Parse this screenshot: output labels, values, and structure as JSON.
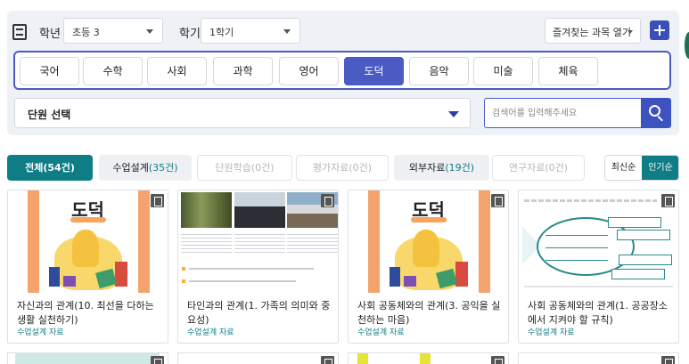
{
  "filter_bar": {
    "grade_label": "학년",
    "grade_value": "초등 3",
    "semester_label": "학기",
    "semester_value": "1학기",
    "favorites_button": "즐겨찾는 과목 열기"
  },
  "subjects": [
    {
      "label": "국어",
      "active": false
    },
    {
      "label": "수학",
      "active": false
    },
    {
      "label": "사회",
      "active": false
    },
    {
      "label": "과학",
      "active": false
    },
    {
      "label": "영어",
      "active": false
    },
    {
      "label": "도덕",
      "active": true
    },
    {
      "label": "음악",
      "active": false
    },
    {
      "label": "미술",
      "active": false
    },
    {
      "label": "체육",
      "active": false
    }
  ],
  "unit_select": {
    "value": "단원 선택"
  },
  "search": {
    "placeholder": "검색어를 입력해주세요"
  },
  "tabs": [
    {
      "label": "전체",
      "count": "(54건)",
      "state": "active"
    },
    {
      "label": "수업설계",
      "count": "(35건)",
      "state": "normal"
    },
    {
      "label": "단원학습",
      "count": "(0건)",
      "state": "disabled"
    },
    {
      "label": "평가자료",
      "count": "(0건)",
      "state": "disabled"
    },
    {
      "label": "외부자료",
      "count": "(19건)",
      "state": "normal"
    },
    {
      "label": "연구자료",
      "count": "(0건)",
      "state": "disabled"
    }
  ],
  "sort": {
    "options": [
      "최신순",
      "인기순"
    ],
    "active": "인기순"
  },
  "cards": [
    {
      "title": "자신과의 관계(10. 최선을 다하는 생활 실천하기)",
      "type": "수업설계 자료",
      "thumb": "moral",
      "thumb_title": "도덕"
    },
    {
      "title": "타인과의 관계(1. 가족의 의미와 중요성)",
      "type": "수업설계 자료",
      "thumb": "photo"
    },
    {
      "title": "사회 공동체와의 관계(3. 공익을 실천하는 마음)",
      "type": "수업설계 자료",
      "thumb": "moral",
      "thumb_title": "도덕"
    },
    {
      "title": "사회 공동체와의 관계(1. 공공장소에서 지켜야 할 규칙)",
      "type": "수업설계 자료",
      "thumb": "fish"
    }
  ],
  "colors": {
    "primary": "#4a5cc4",
    "teal": "#0e7d86",
    "panel_bg": "#eef1f6"
  }
}
